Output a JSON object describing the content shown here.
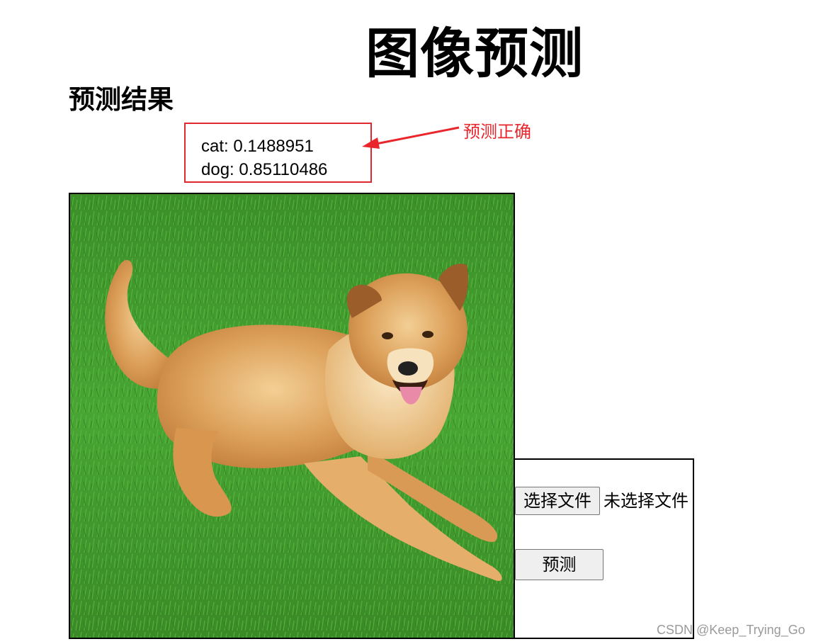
{
  "page": {
    "title": "图像预测"
  },
  "results": {
    "heading": "预测结果",
    "lines": [
      "cat: 0.1488951",
      "dog: 0.85110486"
    ]
  },
  "annotation": {
    "text": "预测正确",
    "color": "#e8262c"
  },
  "form": {
    "file_button_label": "选择文件",
    "file_status": "未选择文件",
    "predict_button_label": "预测"
  },
  "watermark": "CSDN @Keep_Trying_Go",
  "colors": {
    "annotation_red": "#e0282e",
    "grass_green": "#3f9a2c",
    "dog_fur": "#d99a55"
  }
}
